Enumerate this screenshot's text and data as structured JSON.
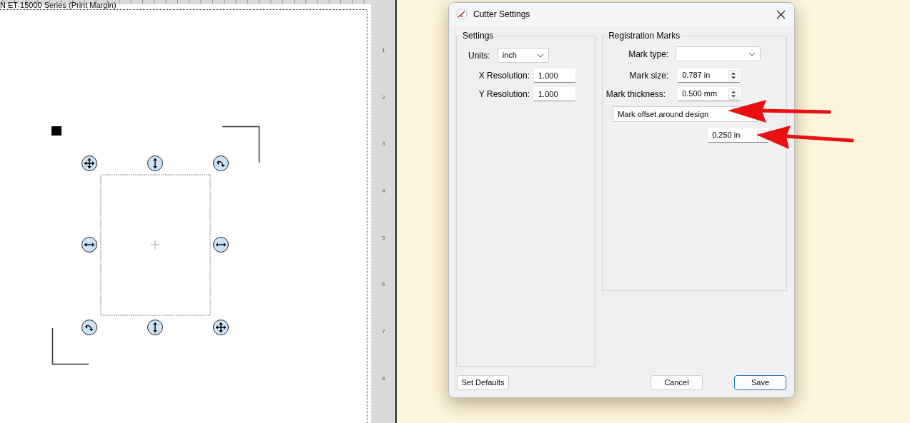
{
  "canvas": {
    "printer_label": "N ET-15000 Series (Print Margin)"
  },
  "ruler": {
    "labels": [
      "1",
      "2",
      "3",
      "4",
      "5",
      "6",
      "7",
      "8"
    ]
  },
  "dialog": {
    "title": "Cutter Settings",
    "settings_group": {
      "title": "Settings",
      "units_label": "Units:",
      "units_value": "inch",
      "x_resolution_label": "X Resolution:",
      "x_resolution_value": "1.000",
      "y_resolution_label": "Y Resolution:",
      "y_resolution_value": "1.000"
    },
    "registration_group": {
      "title": "Registration Marks",
      "mark_type_label": "Mark type:",
      "mark_size_label": "Mark size:",
      "mark_size_value": "0.787 in",
      "mark_thickness_label": "Mark thickness:",
      "mark_thickness_value": "0.500 mm",
      "offset_option": "Mark offset around design",
      "offset_value": "0.250 in"
    },
    "buttons": [
      {
        "label": "Set Defaults",
        "default": false
      },
      {
        "label": "Cancel",
        "default": false
      },
      {
        "label": "Save",
        "default": true
      }
    ]
  }
}
